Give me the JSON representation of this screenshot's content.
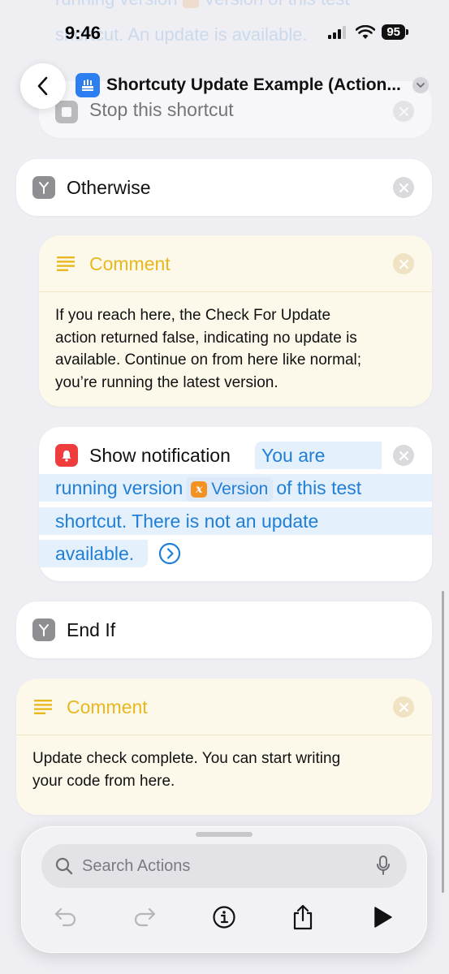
{
  "status_bar": {
    "time": "9:46",
    "battery": "95"
  },
  "background_text": {
    "line1": "running version",
    "line1b": "Version  of this test",
    "line2": "shortcut. An update is available."
  },
  "header": {
    "title": "Shortcuty Update Example (Action..."
  },
  "actions": {
    "stop": {
      "label": "Stop this shortcut"
    },
    "otherwise": {
      "label": "Otherwise"
    },
    "comment1": {
      "label": "Comment",
      "lines": [
        "If you reach here, the Check For Update",
        "action returned false, indicating no update is",
        "available. Continue on from here like normal;",
        "you’re running the latest version."
      ]
    },
    "notification": {
      "label": "Show notification",
      "text_1": "You are",
      "text_2": "running version",
      "variable": "Version",
      "text_3": "of this test",
      "text_4": "shortcut. There is not an update",
      "text_5": "available."
    },
    "end_if": {
      "label": "End If"
    },
    "comment2": {
      "label": "Comment",
      "lines": [
        "Update check complete. You can start writing",
        "your code from here."
      ]
    }
  },
  "bottom_panel": {
    "search_placeholder": "Search Actions"
  },
  "colors": {
    "accent_blue": "#1f7fd6",
    "comment_yellow": "#e9b820",
    "notification_red": "#ef3c3c",
    "variable_orange": "#f39220"
  }
}
